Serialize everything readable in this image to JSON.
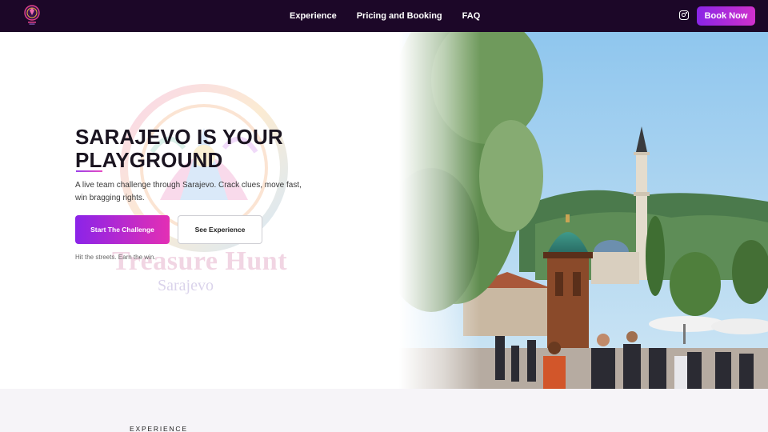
{
  "nav": {
    "logo_icon": "treasure-hunt-logo",
    "links": [
      {
        "label": "Experience"
      },
      {
        "label": "Pricing and Booking"
      },
      {
        "label": "FAQ"
      }
    ],
    "instagram_icon": "instagram-icon",
    "book_label": "Book Now"
  },
  "hero": {
    "title_line1": "SARAJEVO IS YOUR",
    "title_line2": "PLAYGROUND",
    "subtitle": "A live team challenge through Sarajevo. Crack clues, move fast, win bragging rights.",
    "primary_cta": "Start The Challenge",
    "secondary_cta": "See Experience",
    "tagline": "Hit the streets. Earn the win.",
    "watermark_title": "Treasure Hunt",
    "watermark_subtitle": "Sarajevo",
    "photo_subject": "sebilj-fountain-bascarsija-photo"
  },
  "experience": {
    "eyebrow": "EXPERIENCE"
  },
  "colors": {
    "nav_bg": "#1c0728",
    "accent_start": "#8b24e8",
    "accent_end": "#e32fb4",
    "section_bg": "#f6f4f8"
  }
}
